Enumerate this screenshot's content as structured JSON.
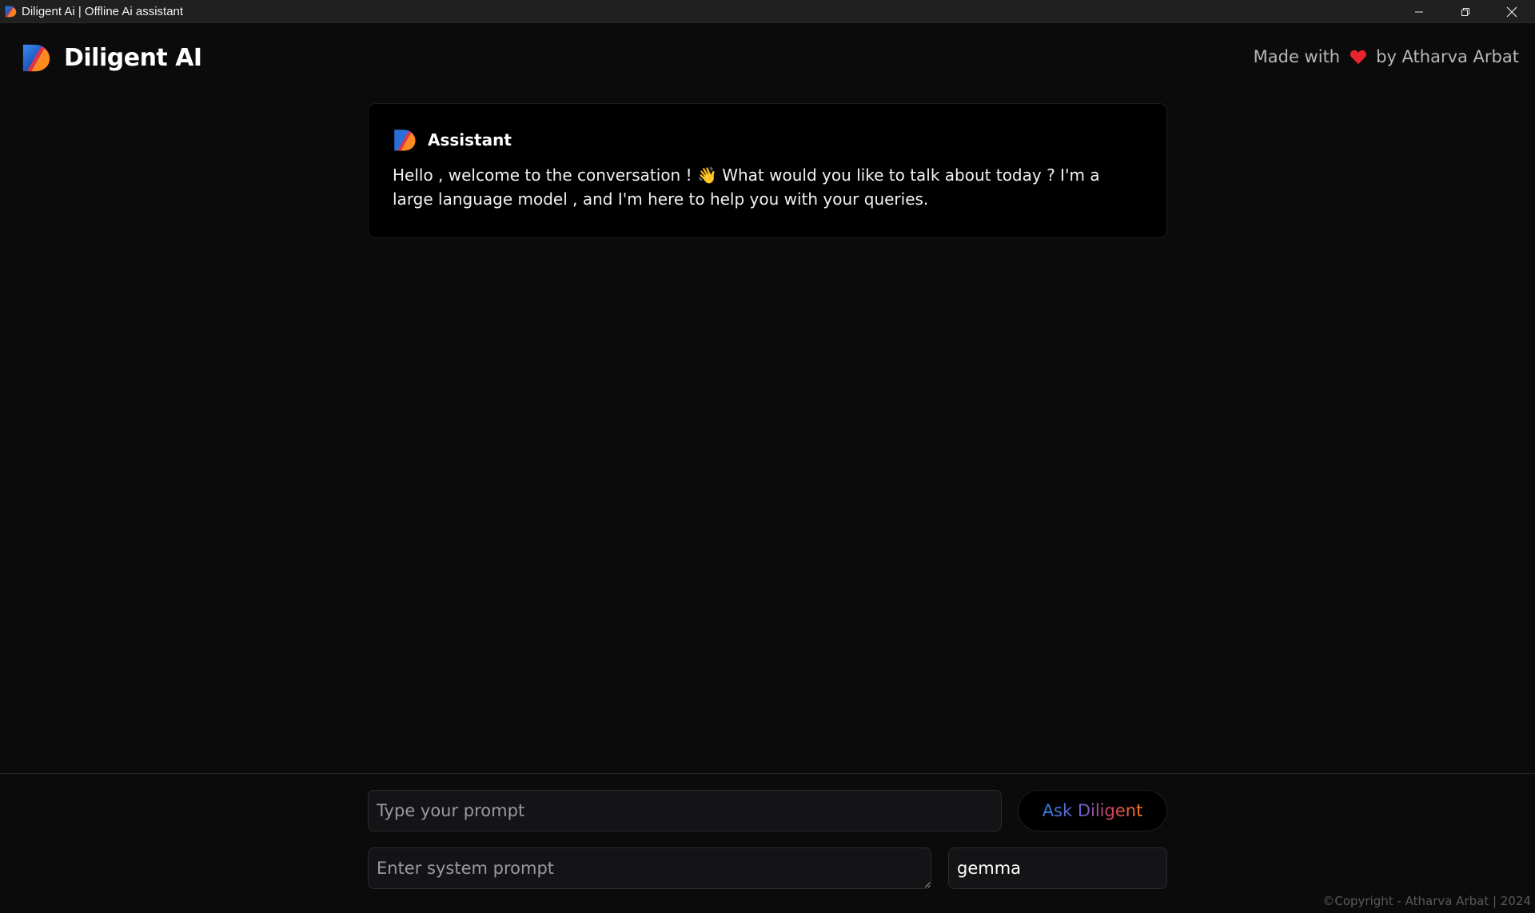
{
  "window": {
    "title": "Diligent Ai | Offline Ai assistant",
    "controls": [
      "minimize-icon",
      "restore-icon",
      "close-icon"
    ]
  },
  "header": {
    "brand_name": "Diligent AI",
    "credit_prefix": "Made with",
    "credit_suffix": "by Atharva Arbat",
    "heart_icon": "heart-icon"
  },
  "chat": {
    "messages": [
      {
        "role": "Assistant",
        "text": "Hello , welcome to the conversation ! 👋 What would you like to talk about today ? I'm a large language model , and I'm here to help you with your queries."
      }
    ]
  },
  "input": {
    "prompt_placeholder": "Type your prompt",
    "ask_button_label": "Ask Diligent",
    "system_prompt_placeholder": "Enter system prompt",
    "model_value": "gemma"
  },
  "footer": {
    "copyright": "©Copyright - Atharva Arbat | 2024"
  },
  "colors": {
    "background": "#0b0b0c",
    "card": "#000000",
    "input_bg": "#141416",
    "gradient": [
      "#2f7de1",
      "#d8435a",
      "#ff7a1a"
    ],
    "heart": "#e8242f"
  }
}
